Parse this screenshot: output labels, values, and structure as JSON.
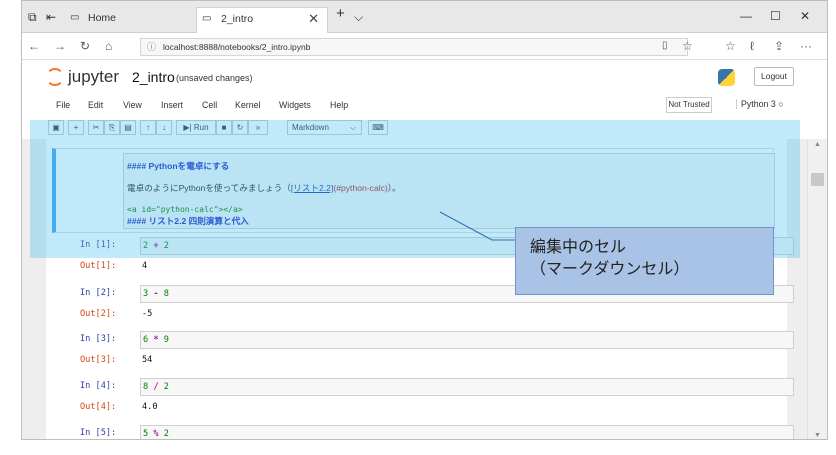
{
  "browser": {
    "tabs": [
      {
        "label": "Home"
      },
      {
        "label": "2_intro"
      }
    ],
    "url": "localhost:8888/notebooks/2_intro.ipynb"
  },
  "jupyter": {
    "brand": "jupyter",
    "notebook_name": "2_intro",
    "status": "(unsaved changes)",
    "logout_label": "Logout",
    "menu": [
      "File",
      "Edit",
      "View",
      "Insert",
      "Cell",
      "Kernel",
      "Widgets",
      "Help"
    ],
    "trust": "Not Trusted",
    "kernel": "Python 3",
    "run_label": "Run",
    "cell_type": "Markdown"
  },
  "markdown_cell": {
    "line1": "#### Pythonを電卓にする",
    "line2_text": "電卓のようにPythonを使ってみましょう（",
    "line2_link": "[リスト2.2]",
    "line2_ref": "(#python-calc)",
    "line2_end": "）。",
    "line3": "<a id=\"python-calc\"></a>",
    "line4": "#### リスト2.2 四則演算と代入"
  },
  "cells": [
    {
      "in": "In [1]:",
      "a": "2",
      "op": "+",
      "b": "2",
      "out_label": "Out[1]:",
      "out": "4"
    },
    {
      "in": "In [2]:",
      "a": "3",
      "op": "-",
      "b": "8",
      "out_label": "Out[2]:",
      "out": "-5"
    },
    {
      "in": "In [3]:",
      "a": "6",
      "op": "*",
      "b": "9",
      "out_label": "Out[3]:",
      "out": "54"
    },
    {
      "in": "In [4]:",
      "a": "8",
      "op": "/",
      "b": "2",
      "out_label": "Out[4]:",
      "out": "4.0"
    },
    {
      "in": "In [5]:",
      "a": "5",
      "op": "%",
      "b": "2"
    }
  ],
  "annotation": {
    "line1": "編集中のセル",
    "line2": "（マークダウンセル）"
  }
}
